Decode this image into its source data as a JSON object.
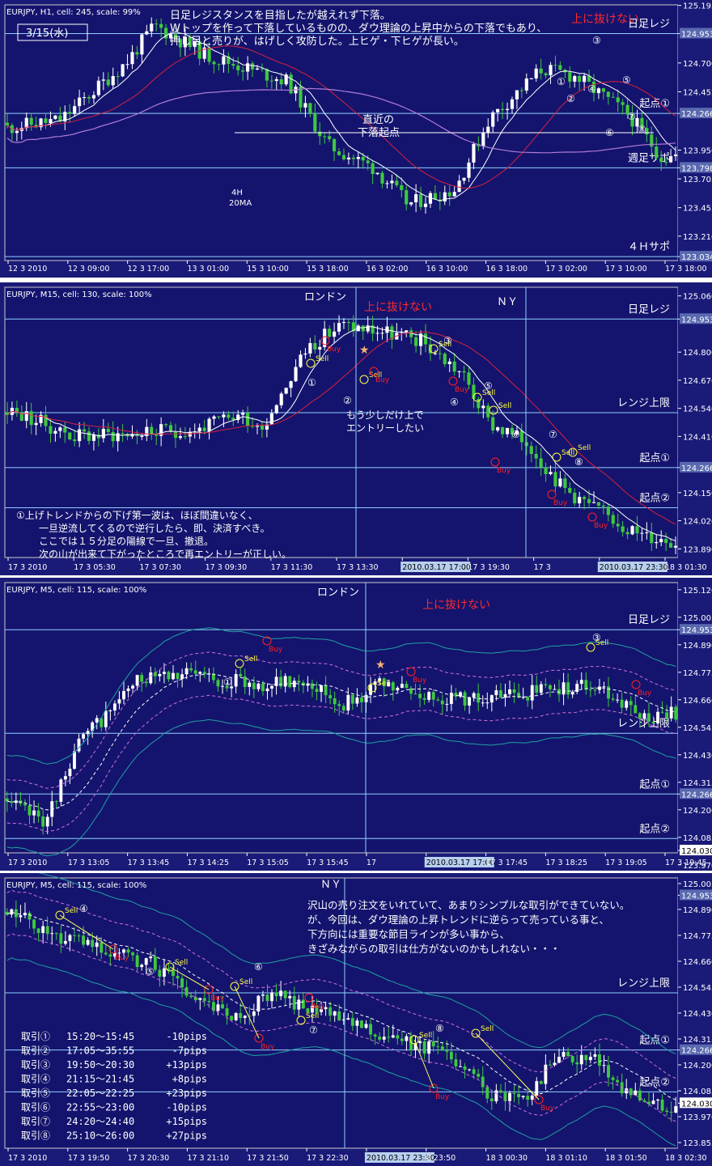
{
  "colors": {
    "background": "#1a1a78",
    "plot_bg": "#14146e",
    "bull": "#ffffff",
    "bear": "#3ec83e",
    "grid_line": "#8fd0ff",
    "label_red": "#ff2a2a",
    "ma_white": "#ffffff",
    "ma_red": "#d8203c",
    "ma_purple": "#b07ad8",
    "bb_band": "#20a0a0",
    "sell": "#ffff40",
    "buy": "#ff2020"
  },
  "chart_data": [
    {
      "type": "candlestick",
      "header": "EURJPY, H1, cell: 245, scale: 99%",
      "date_box": "3/15(水)",
      "comment_lines": [
        "日足レジスタンスを目指したが越えれず下落。",
        "Wトップを作って下落しているものの、ダウ理論の上昇中からの下落でもあり、",
        "押し目と売りが、はげしく攻防した。上ヒゲ・下ヒゲが長い。"
      ],
      "red_note": "上に抜けない",
      "ma_label_1": "4H",
      "ma_label_2": "20MA",
      "swing_label_1": "直近の",
      "swing_label_2": "下落起点",
      "ylim": [
        123.0,
        125.2
      ],
      "y_ticks": [
        "125.195",
        "124.953",
        "124.700",
        "124.452",
        "124.266",
        "123.950",
        "123.798",
        "123.703",
        "123.455",
        "123.210",
        "123.034"
      ],
      "highlight_ticks": [
        "124.953",
        "124.266",
        "123.798",
        "123.034"
      ],
      "x_ticks": [
        "12 3 2010",
        "12 3 09:00",
        "12 3 17:00",
        "13 3 01:00",
        "15 3 10:00",
        "15 3 18:00",
        "16 3 02:00",
        "16 3 10:00",
        "16 3 18:00",
        "17 3 02:00",
        "17 3 10:00",
        "17 3 18:00"
      ],
      "levels": [
        {
          "value": 124.953,
          "label": "日足レジ"
        },
        {
          "value": 124.266,
          "label": "起点①"
        },
        {
          "value": 123.798,
          "label": "週足サポ"
        },
        {
          "value": 123.034,
          "label": "４Ｈサポ"
        }
      ],
      "swing_low_level": 124.1,
      "markers": [
        "①",
        "②",
        "③",
        "④",
        "⑤",
        "⑥",
        "⑦",
        "⑧"
      ]
    },
    {
      "type": "candlestick",
      "header": "EURJPY, M15, cell: 130, scale: 100%",
      "session_1": "ロンドン",
      "session_2": "ＮＹ",
      "red_note": "上に抜けない",
      "entry_note_1": "もう少しだけ上で",
      "entry_note_2": "エントリーしたい",
      "ylim": [
        123.85,
        125.1
      ],
      "y_ticks": [
        "125.060",
        "124.953",
        "124.800",
        "124.670",
        "124.540",
        "124.410",
        "124.266",
        "124.150",
        "124.020",
        "123.890"
      ],
      "highlight_ticks": [
        "124.953",
        "124.266"
      ],
      "x_ticks": [
        "17 3 2010",
        "17 3 05:30",
        "17 3 07:30",
        "17 3 09:30",
        "17 3 11:30",
        "17 3 13:30",
        "2010.03.17 17:00",
        "17 3 19:30",
        "17 3",
        "2010.03.17 23:30",
        "18 3 01:30"
      ],
      "levels": [
        {
          "value": 124.953,
          "label": "日足レジ"
        },
        {
          "value": 124.52,
          "label": "レンジ上限"
        },
        {
          "value": 124.266,
          "label": "起点①"
        },
        {
          "value": 124.08,
          "label": "起点②"
        }
      ],
      "comment_lines": [
        "①上げトレンドからの下げ第一波は、ほぼ間違いなく、",
        "一旦逆流してくるので逆行したら、即、決済すべき。",
        "ここでは１５分足の陽線で一旦、撤退。",
        "次の山が出来て下がったところで再エントリーが正しい。"
      ],
      "trade_labels": [
        "Sell",
        "Buy"
      ],
      "markers": [
        "①",
        "②",
        "③",
        "④",
        "⑤",
        "⑥",
        "⑦",
        "⑧"
      ]
    },
    {
      "type": "candlestick",
      "header": "EURJPY, M5, cell: 115, scale: 100%",
      "session_1": "ロンドン",
      "red_note": "上に抜けない",
      "ylim": [
        124.02,
        125.15
      ],
      "y_ticks": [
        "125.120",
        "125.005",
        "124.953",
        "124.890",
        "124.775",
        "124.660",
        "124.545",
        "124.430",
        "124.315",
        "124.266",
        "124.200",
        "124.085",
        "124.030",
        "123.970"
      ],
      "highlight_ticks": [
        "124.953",
        "124.266",
        "124.030"
      ],
      "x_ticks": [
        "17 3 2010",
        "17 3 13:05",
        "17 3 13:45",
        "17 3 14:25",
        "17 3 15:05",
        "17 3 15:45",
        "17",
        "2010.03.17 17:00",
        "17 3 17:45",
        "17 3 18:25",
        "17 3 19:05",
        "17 3 19:45"
      ],
      "levels": [
        {
          "value": 124.953,
          "label": "日足レジ"
        },
        {
          "value": 124.52,
          "label": "レンジ上限"
        },
        {
          "value": 124.266,
          "label": "起点①"
        },
        {
          "value": 124.08,
          "label": "起点②"
        }
      ],
      "trade_labels": [
        "Sell",
        "Buy"
      ],
      "markers": [
        "①",
        "③"
      ]
    },
    {
      "type": "candlestick",
      "header": "EURJPY, M5, cell: 115, scale: 100%",
      "session_2": "ＮＹ",
      "comment_lines": [
        "沢山の売り注文をいれていて、あまりシンプルな取引ができていない。",
        "が、今回は、ダウ理論の上昇トレンドに逆らって売っている事と、",
        "下方向には重要な節目ラインが多い事から、",
        "きざみながらの取引は仕方がないのかもしれない・・・"
      ],
      "ylim": [
        123.83,
        125.03
      ],
      "y_ticks": [
        "125.005",
        "124.953",
        "124.890",
        "124.775",
        "124.660",
        "124.545",
        "124.430",
        "124.315",
        "124.266",
        "124.200",
        "124.085",
        "124.030",
        "123.970",
        "123.855"
      ],
      "highlight_ticks": [
        "124.953",
        "124.266",
        "124.030"
      ],
      "x_ticks": [
        "17 3 2010",
        "17 3 19:50",
        "17 3 20:30",
        "17 3 21:10",
        "17 3 21:50",
        "17 3 22:30",
        "2010.03.17 23:30",
        "3 23:50",
        "18 3 00:30",
        "18 3 01:10",
        "18 3 01:50",
        "18 3 02:30"
      ],
      "levels": [
        {
          "value": 124.52,
          "label": "レンジ上限"
        },
        {
          "value": 124.266,
          "label": "起点①"
        },
        {
          "value": 124.08,
          "label": "起点②"
        }
      ],
      "trade_labels": [
        "Sell",
        "Buy"
      ],
      "markers": [
        "④",
        "⑤",
        "⑥",
        "⑦",
        "⑧"
      ],
      "trades": [
        {
          "name": "取引①",
          "time": "15:20～15:45",
          "result": "-10pips"
        },
        {
          "name": "取引②",
          "time": "17:05～35:55",
          "result": "-7pips"
        },
        {
          "name": "取引③",
          "time": "19:50～20:30",
          "result": "+13pips"
        },
        {
          "name": "取引④",
          "time": "21:15～21:45",
          "result": "+8pips"
        },
        {
          "name": "取引⑤",
          "time": "22:05～22:25",
          "result": "+23pips"
        },
        {
          "name": "取引⑥",
          "time": "22:55～23:00",
          "result": "-10pips"
        },
        {
          "name": "取引⑦",
          "time": "24:20～24:40",
          "result": "+15pips"
        },
        {
          "name": "取引⑧",
          "time": "25:10～26:00",
          "result": "+27pips"
        }
      ]
    }
  ]
}
